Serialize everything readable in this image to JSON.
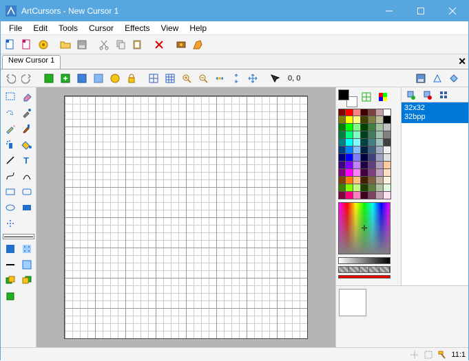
{
  "title": "ArtCursors - New Cursor 1",
  "menu": [
    "File",
    "Edit",
    "Tools",
    "Cursor",
    "Effects",
    "View",
    "Help"
  ],
  "tabs": [
    {
      "label": "New Cursor 1"
    }
  ],
  "coord": "0, 0",
  "zoom": "11:1",
  "format": {
    "size": "32x32",
    "depth": "32bpp"
  },
  "palette": [
    [
      "#800000",
      "#ff0000",
      "#ff8080",
      "#400000",
      "#804040",
      "#c0a0a0",
      "#ffffff"
    ],
    [
      "#808000",
      "#ffff00",
      "#ffff80",
      "#404000",
      "#808040",
      "#c0c0a0",
      "#000000"
    ],
    [
      "#008000",
      "#00ff00",
      "#80ff80",
      "#004000",
      "#408040",
      "#a0c0a0",
      "#c0c0c0"
    ],
    [
      "#008040",
      "#00ff80",
      "#80ffc0",
      "#004020",
      "#408060",
      "#a0c0b0",
      "#808080"
    ],
    [
      "#008080",
      "#00ffff",
      "#80ffff",
      "#004040",
      "#408080",
      "#a0c0c0",
      "#404040"
    ],
    [
      "#004080",
      "#0080ff",
      "#80c0ff",
      "#002040",
      "#406080",
      "#a0b0c0",
      "#f0f0f0"
    ],
    [
      "#000080",
      "#0000ff",
      "#8080ff",
      "#000040",
      "#404080",
      "#a0a0c0",
      "#e0e0e0"
    ],
    [
      "#400080",
      "#8000ff",
      "#c080ff",
      "#200040",
      "#604080",
      "#b0a0c0",
      "#ffc8a0"
    ],
    [
      "#800080",
      "#ff00ff",
      "#ff80ff",
      "#400040",
      "#804080",
      "#c0a0c0",
      "#ffe0c0"
    ],
    [
      "#804000",
      "#ff8000",
      "#ffc080",
      "#402000",
      "#806040",
      "#c0b0a0",
      "#fff0e0"
    ],
    [
      "#408000",
      "#80ff00",
      "#c0ff80",
      "#204000",
      "#608040",
      "#b0c0a0",
      "#e0ffe0"
    ],
    [
      "#800040",
      "#ff0080",
      "#ff80c0",
      "#400020",
      "#804060",
      "#c0a0b0",
      "#ffe0f0"
    ]
  ],
  "toolbar1_icons": [
    "new-icon",
    "new-lib-icon",
    "new-set-icon",
    "open-icon",
    "save-icon",
    "cut-icon",
    "copy-icon",
    "paste-icon",
    "delete-icon",
    "capture-icon",
    "help-icon"
  ],
  "toolbar2_icons_a": [
    "undo-icon",
    "redo-icon"
  ],
  "toolbar2_icons_b": [
    "layer-green-icon",
    "layer-add-icon",
    "layer-props-icon",
    "layer-icon",
    "layer-mask-icon",
    "layer-lock-icon"
  ],
  "toolbar2_icons_c": [
    "grid-icon",
    "grid2-icon",
    "zoom-in-icon",
    "zoom-out-icon",
    "fit-icon",
    "actual-icon",
    "arrows-icon",
    "hotspot-icon"
  ],
  "toolbox_rows": [
    [
      "select-rect",
      "eraser"
    ],
    [
      "freehand",
      "picker"
    ],
    [
      "pencil",
      "brush"
    ],
    [
      "spray",
      "flood"
    ],
    [
      "line",
      "text"
    ],
    [
      "curve",
      "arc"
    ],
    [
      "rect",
      "rrect"
    ],
    [
      "ellipse",
      "fillrect"
    ],
    [
      "star",
      "none"
    ]
  ],
  "toolbox_bottom_rows": [
    [
      "pattern-blue",
      "pattern-dots"
    ],
    [
      "stroke-line",
      "fill-sample"
    ],
    [
      "obj-green",
      "obj-yellow"
    ],
    [
      "obj-single",
      "none"
    ]
  ],
  "status_icons": [
    "crosshair-icon",
    "resize-icon",
    "hammer-icon"
  ]
}
